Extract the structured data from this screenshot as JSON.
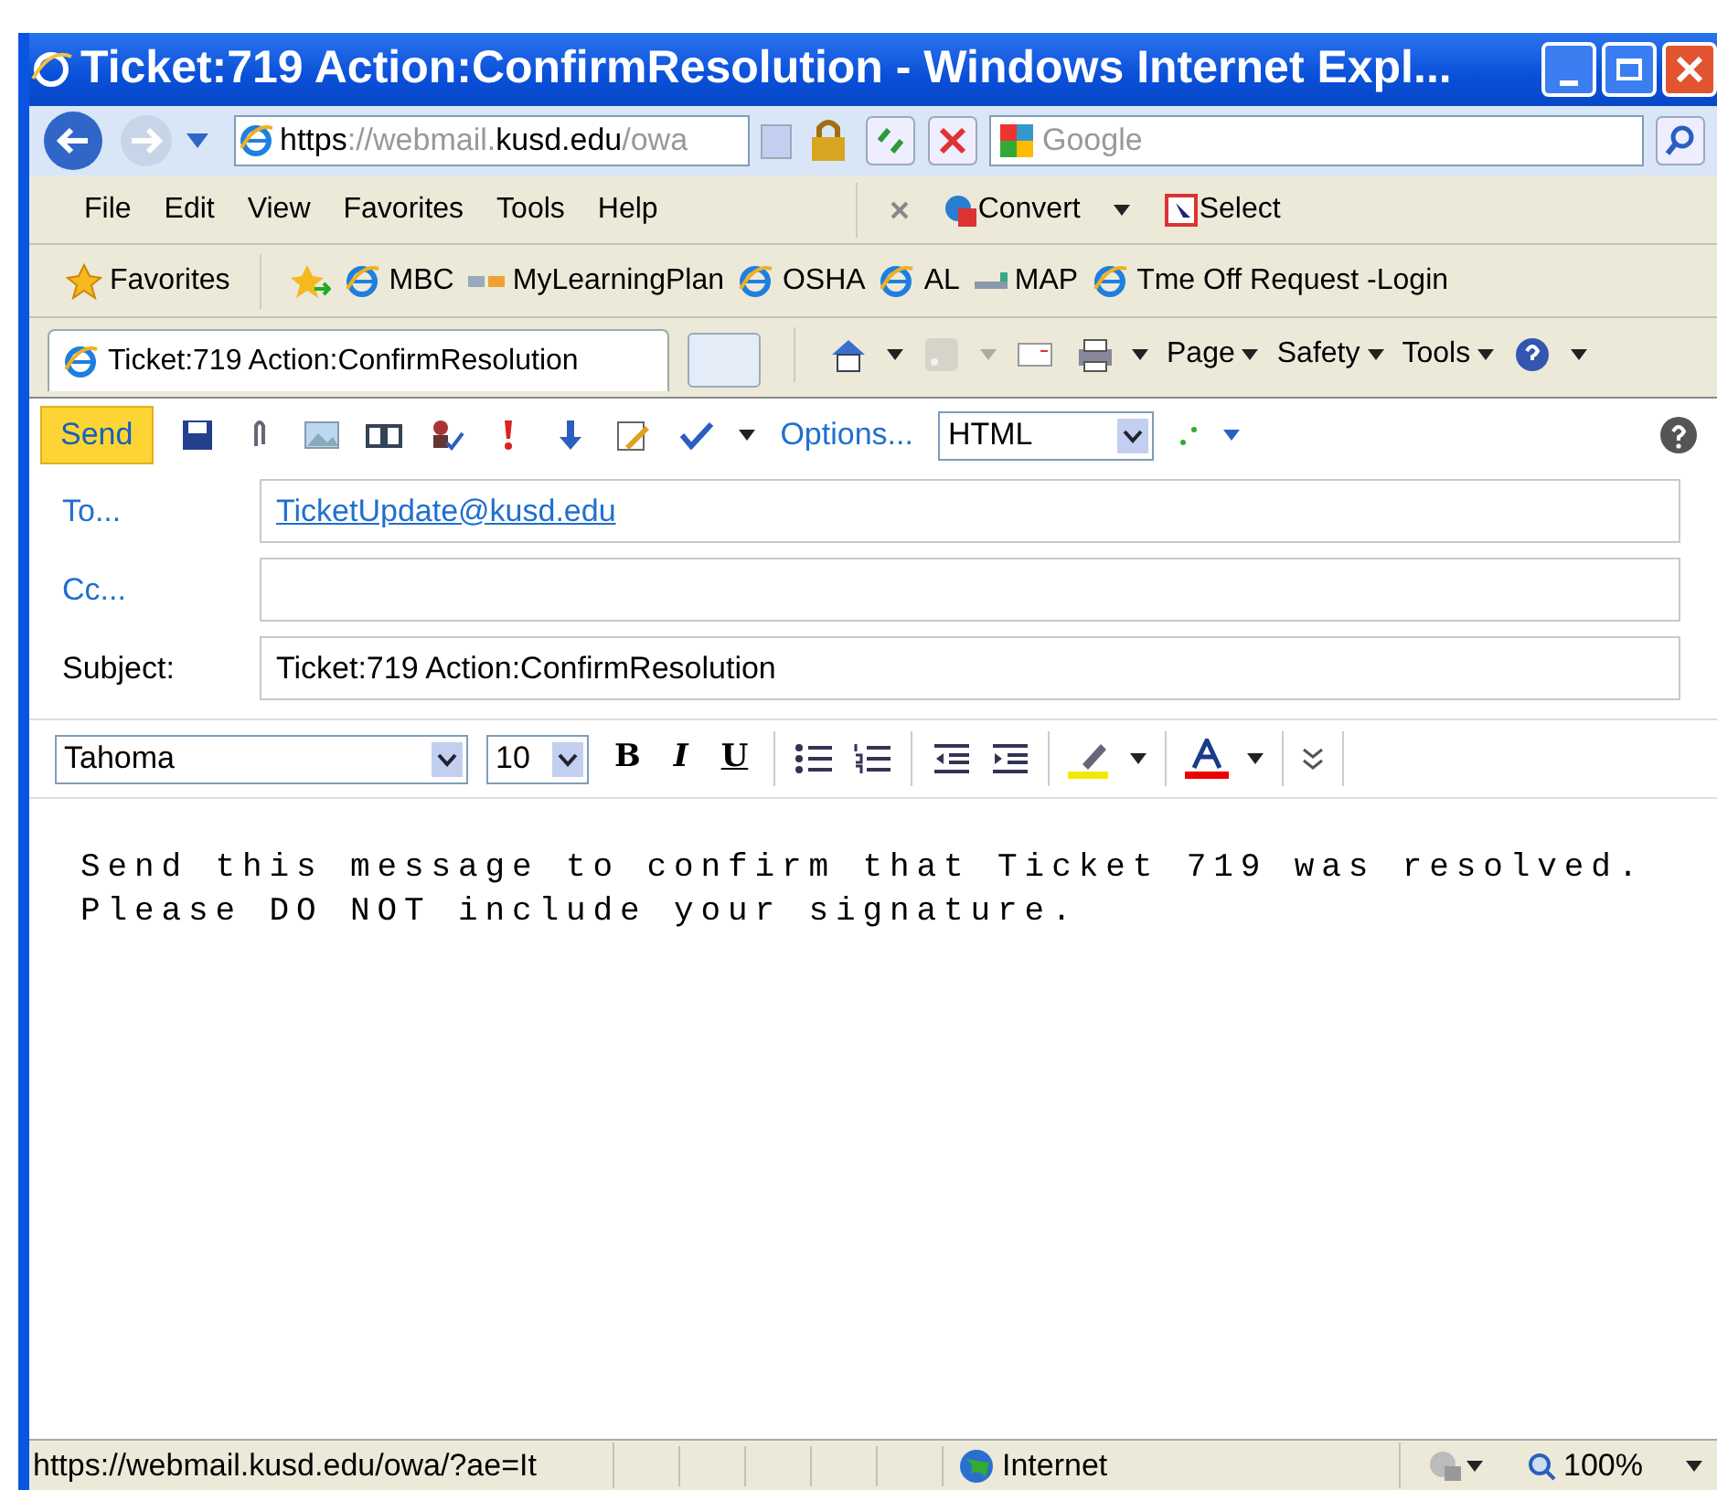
{
  "window": {
    "title": "Ticket:719 Action:ConfirmResolution - Windows Internet Expl..."
  },
  "address": {
    "url_parts": [
      {
        "text": "https",
        "dim": false
      },
      {
        "text": "://webmail.",
        "dim": true
      },
      {
        "text": "kusd.edu",
        "dim": false
      },
      {
        "text": "/owa",
        "dim": true
      }
    ]
  },
  "search": {
    "placeholder": "Google"
  },
  "menu": [
    "File",
    "Edit",
    "View",
    "Favorites",
    "Tools",
    "Help"
  ],
  "command_links": [
    {
      "kind": "convert",
      "label": "Convert"
    },
    {
      "kind": "select",
      "label": "Select"
    }
  ],
  "favorites": {
    "label": "Favorites",
    "links": [
      {
        "kind": "ie",
        "label": "MBC"
      },
      {
        "kind": "mlp",
        "label": "MyLearningPlan"
      },
      {
        "kind": "ie",
        "label": "OSHA"
      },
      {
        "kind": "ie",
        "label": "AL"
      },
      {
        "kind": "nwea",
        "label": "MAP"
      },
      {
        "kind": "ie",
        "label": "Tme Off Request -Login"
      }
    ]
  },
  "tabs": [
    {
      "label": "Ticket:719 Action:ConfirmResolution",
      "selected": true
    }
  ],
  "command_bar": [
    {
      "kind": "home",
      "disabled": false
    },
    {
      "kind": "feed",
      "disabled": true
    },
    {
      "kind": "mail",
      "disabled": false
    },
    {
      "kind": "print",
      "disabled": false
    },
    {
      "kind": "menu",
      "label": "Page",
      "disabled": false
    },
    {
      "kind": "menu",
      "label": "Safety",
      "disabled": false
    },
    {
      "kind": "menu",
      "label": "Tools",
      "disabled": false
    },
    {
      "kind": "help",
      "disabled": false
    }
  ],
  "compose_toolbar": {
    "send": "Send",
    "tools": [
      {
        "kind": "save"
      },
      {
        "kind": "attach"
      },
      {
        "kind": "image"
      },
      {
        "kind": "book"
      },
      {
        "kind": "check-names"
      },
      {
        "kind": "importance-high"
      },
      {
        "kind": "importance-low"
      },
      {
        "kind": "signature"
      },
      {
        "kind": "spelling"
      }
    ],
    "options": "Options...",
    "format": "HTML"
  },
  "fields": [
    {
      "label": "To...",
      "link": true,
      "value": "TicketUpdate@kusd.edu"
    },
    {
      "label": "Cc...",
      "link": true
    },
    {
      "label": "Subject:",
      "link": false,
      "value": "Ticket:719 Action:ConfirmResolution"
    }
  ],
  "format_bar": {
    "font": "Tahoma",
    "size": "10",
    "styles": [
      "B",
      "I",
      "U"
    ]
  },
  "body": [
    "Send this message to confirm that Ticket 719 was resolved.",
    "Please DO NOT include your signature."
  ],
  "status_bar": {
    "url": "https://webmail.kusd.edu/owa/?ae=It",
    "zone": "Internet",
    "zoom": "100%"
  }
}
